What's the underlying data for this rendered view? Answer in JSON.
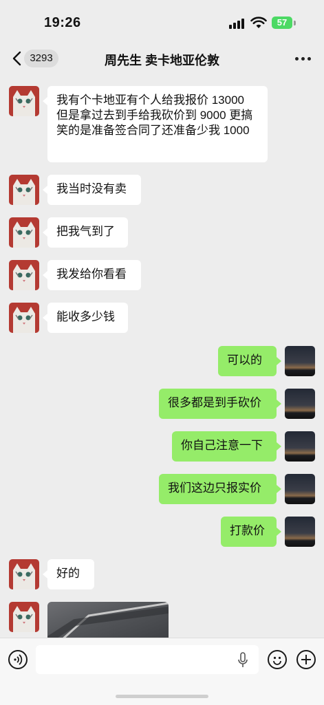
{
  "status_bar": {
    "time": "19:26",
    "battery": "57"
  },
  "header": {
    "unread_count": "3293",
    "title": "周先生 卖卡地亚伦敦"
  },
  "messages": [
    {
      "side": "left",
      "text": "我有个卡地亚有个人给我报价 13000 但是拿过去到手给我砍价到 9000 更搞笑的是准备签合同了还准备少我 1000"
    },
    {
      "side": "left",
      "text": "我当时没有卖"
    },
    {
      "side": "left",
      "text": "把我气到了"
    },
    {
      "side": "left",
      "text": "我发给你看看"
    },
    {
      "side": "left",
      "text": "能收多少钱"
    },
    {
      "side": "right",
      "text": "可以的"
    },
    {
      "side": "right",
      "text": "很多都是到手砍价"
    },
    {
      "side": "right",
      "text": "你自己注意一下"
    },
    {
      "side": "right",
      "text": "我们这边只报实价"
    },
    {
      "side": "right",
      "text": "打款价"
    },
    {
      "side": "left",
      "text": "好的"
    },
    {
      "side": "left",
      "type": "image"
    }
  ],
  "input_bar": {
    "placeholder": ""
  },
  "icons": {
    "back": "chevron-left-icon",
    "more": "more-dots-icon",
    "voice": "voice-icon",
    "mic": "microphone-icon",
    "emoji": "emoji-icon",
    "plus": "plus-icon"
  },
  "colors": {
    "sent_bubble": "#95ec69",
    "received_bubble": "#ffffff",
    "background": "#ededed",
    "battery": "#4cd964"
  }
}
